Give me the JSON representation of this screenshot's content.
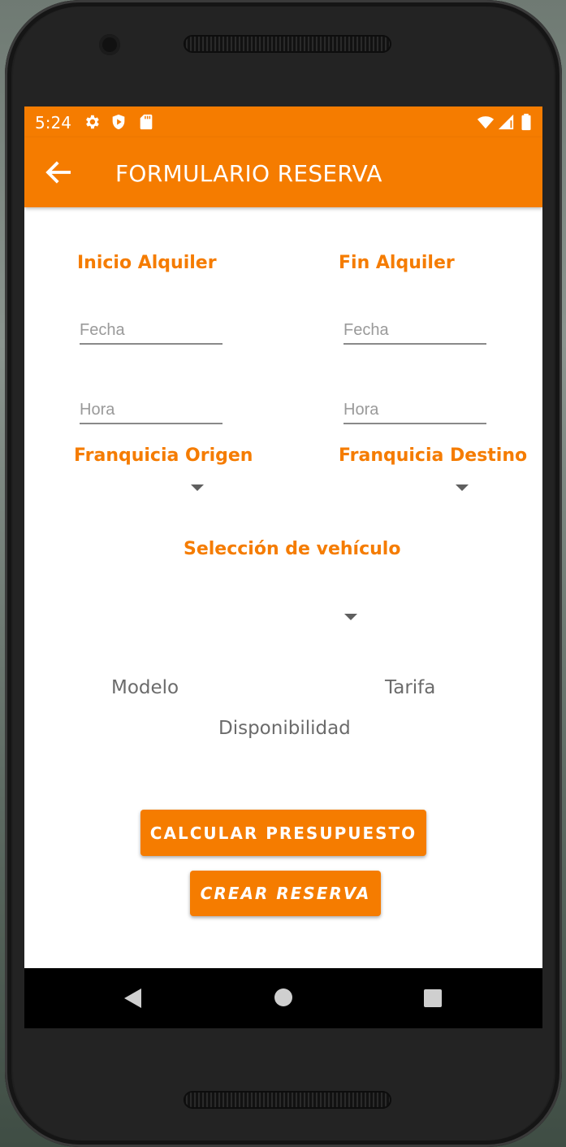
{
  "status_bar": {
    "time": "5:24",
    "left_icons": [
      "gear-icon",
      "shield-icon",
      "sd-card-icon"
    ],
    "right_icons": [
      "wifi-icon",
      "signal-icon",
      "battery-icon"
    ]
  },
  "app_bar": {
    "title": "FORMULARIO RESERVA",
    "back_icon": "arrow-left-icon",
    "color": "#f57c00"
  },
  "form": {
    "inicio_label": "Inicio Alquiler",
    "fin_label": "Fin Alquiler",
    "inicio_fecha_placeholder": "Fecha",
    "inicio_hora_placeholder": "Hora",
    "fin_fecha_placeholder": "Fecha",
    "fin_hora_placeholder": "Hora",
    "franquicia_origen_label": "Franquicia Origen",
    "franquicia_destino_label": "Franquicia Destino",
    "seleccion_vehiculo_label": "Selección de vehículo",
    "modelo_label": "Modelo",
    "tarifa_label": "Tarifa",
    "disponibilidad_label": "Disponibilidad"
  },
  "buttons": {
    "calcular": "CALCULAR PRESUPUESTO",
    "crear": "CREAR RESERVA"
  },
  "nav_bar": {
    "icons": [
      "nav-back-icon",
      "nav-home-icon",
      "nav-recents-icon"
    ]
  },
  "colors": {
    "accent": "#f57c00",
    "text_gray": "#6b6b6b"
  }
}
